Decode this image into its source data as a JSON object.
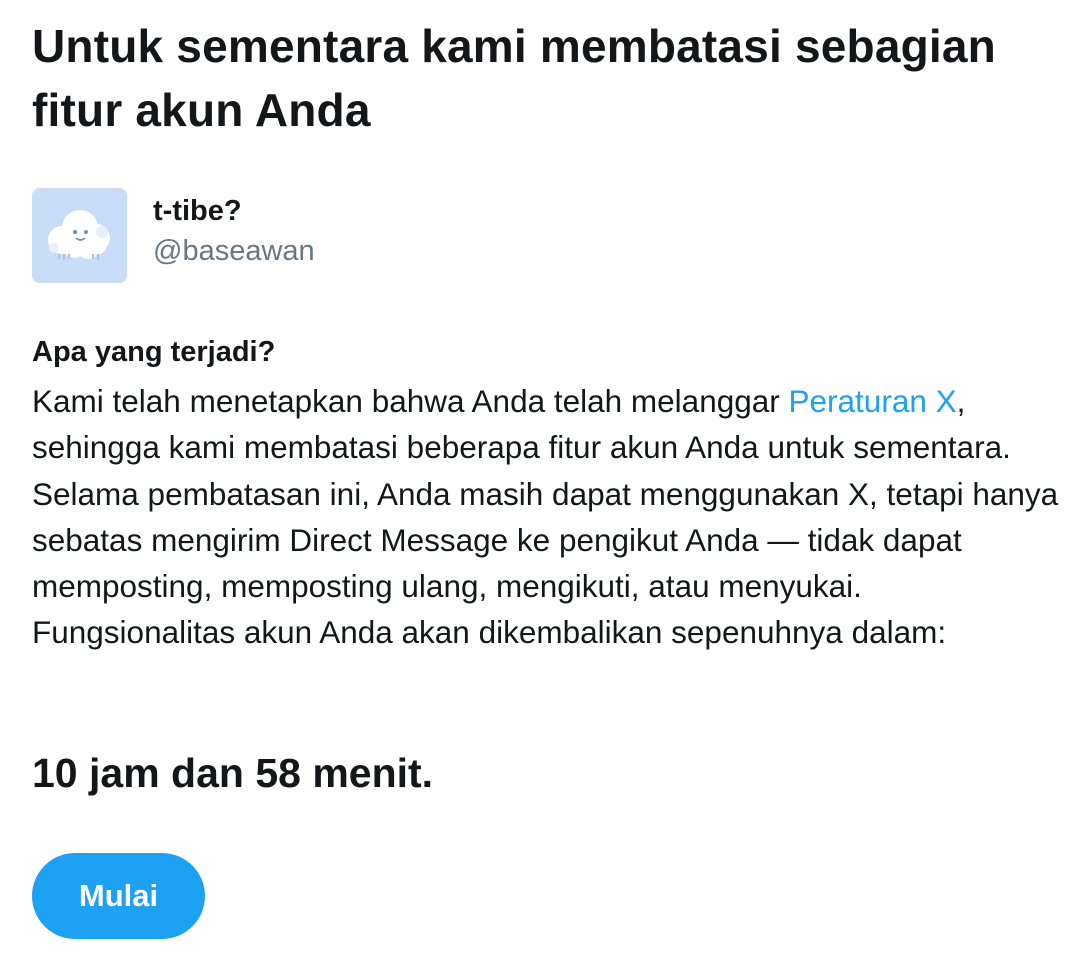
{
  "header": {
    "title": "Untuk sementara kami membatasi sebagian fitur akun Anda"
  },
  "account": {
    "display_name": "t-tibe?",
    "handle": "@baseawan",
    "avatar_icon": "cloud-avatar-icon"
  },
  "notice": {
    "heading": "Apa yang terjadi?",
    "text_before_link": "Kami telah menetapkan bahwa Anda telah melanggar ",
    "link_label": "Peraturan X",
    "text_after_link": ", sehingga kami membatasi beberapa fitur akun Anda untuk sementara. Selama pembatasan ini, Anda masih dapat menggunakan X, tetapi hanya sebatas mengirim Direct Message ke pengikut Anda — tidak dapat memposting, memposting ulang, mengikuti, atau menyukai. Fungsionalitas akun Anda akan dikembalikan sepenuhnya dalam:",
    "countdown": "10 jam dan 58 menit."
  },
  "actions": {
    "start_label": "Mulai"
  },
  "colors": {
    "accent": "#1da1f2",
    "text_primary": "#14171a",
    "text_secondary": "#657786",
    "avatar_background": "#c9dcf8"
  }
}
